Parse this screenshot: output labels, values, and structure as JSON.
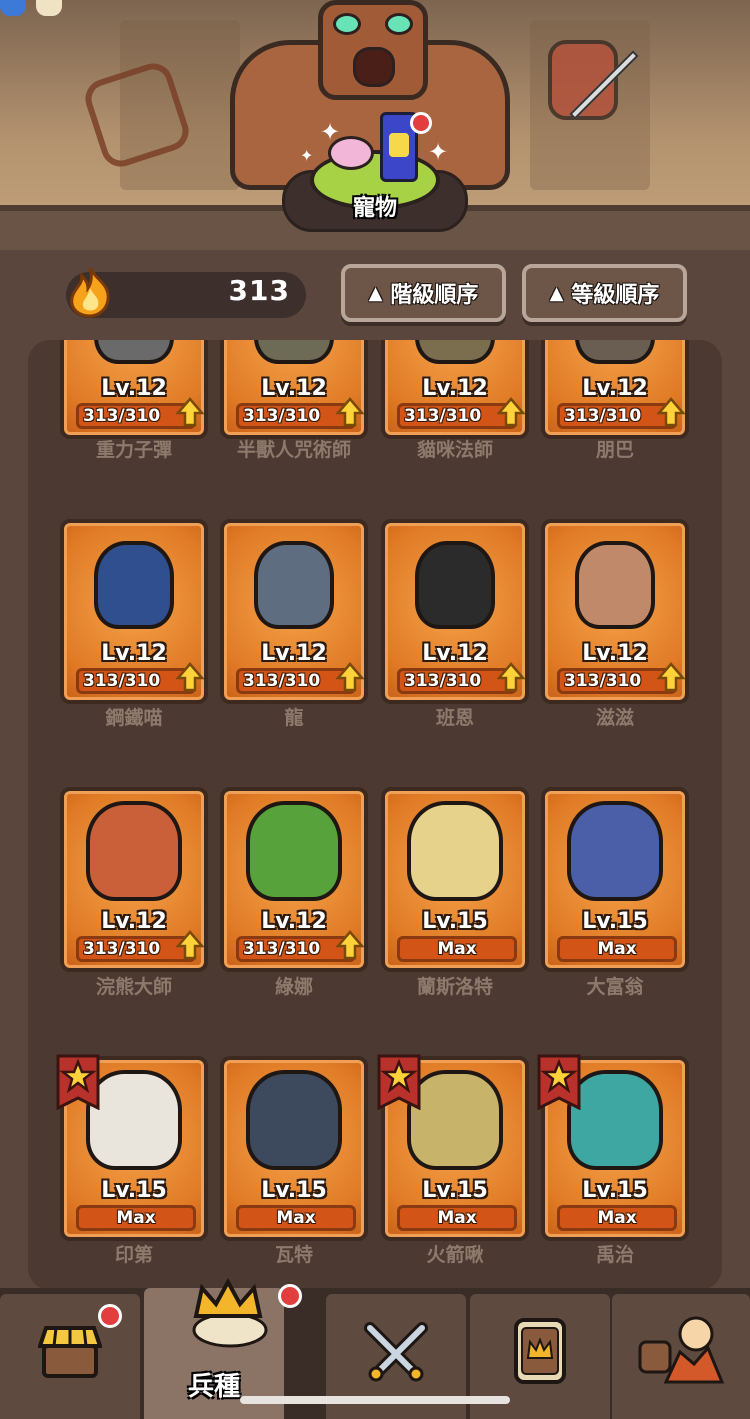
{
  "header": {
    "pet_label": "寵物"
  },
  "resource": {
    "icon": "flame-icon",
    "value": "313"
  },
  "sort_buttons": [
    {
      "label": "階級順序",
      "icon": "triangle-up-icon"
    },
    {
      "label": "等級順序",
      "icon": "triangle-up-icon"
    }
  ],
  "units": [
    {
      "name": "重力子彈",
      "level": "Lv.12",
      "progress": "313/310",
      "upgradable": true,
      "starred": false,
      "color": "#6a6a6a"
    },
    {
      "name": "半獸人咒術師",
      "level": "Lv.12",
      "progress": "313/310",
      "upgradable": true,
      "starred": false,
      "color": "#6d6a55"
    },
    {
      "name": "貓咪法師",
      "level": "Lv.12",
      "progress": "313/310",
      "upgradable": true,
      "starred": false,
      "color": "#7a6e4e"
    },
    {
      "name": "朋巴",
      "level": "Lv.12",
      "progress": "313/310",
      "upgradable": true,
      "starred": false,
      "color": "#6a5e52"
    },
    {
      "name": "鋼鐵喵",
      "level": "Lv.12",
      "progress": "313/310",
      "upgradable": true,
      "starred": false,
      "color": "#2f4f8f"
    },
    {
      "name": "龍",
      "level": "Lv.12",
      "progress": "313/310",
      "upgradable": true,
      "starred": false,
      "color": "#5f6d80"
    },
    {
      "name": "班恩",
      "level": "Lv.12",
      "progress": "313/310",
      "upgradable": true,
      "starred": false,
      "color": "#2b2b2b"
    },
    {
      "name": "滋滋",
      "level": "Lv.12",
      "progress": "313/310",
      "upgradable": true,
      "starred": false,
      "color": "#c08a6a"
    },
    {
      "name": "浣熊大師",
      "level": "Lv.12",
      "progress": "313/310",
      "upgradable": true,
      "starred": false,
      "color": "#c9603a"
    },
    {
      "name": "綠娜",
      "level": "Lv.12",
      "progress": "313/310",
      "upgradable": true,
      "starred": false,
      "color": "#58a23c"
    },
    {
      "name": "蘭斯洛特",
      "level": "Lv.15",
      "progress": "Max",
      "upgradable": false,
      "starred": false,
      "color": "#e6d28a"
    },
    {
      "name": "大富翁",
      "level": "Lv.15",
      "progress": "Max",
      "upgradable": false,
      "starred": false,
      "color": "#4a5fa8"
    },
    {
      "name": "印第",
      "level": "Lv.15",
      "progress": "Max",
      "upgradable": false,
      "starred": true,
      "color": "#e9e4dc"
    },
    {
      "name": "瓦特",
      "level": "Lv.15",
      "progress": "Max",
      "upgradable": false,
      "starred": false,
      "color": "#3d4a5e"
    },
    {
      "name": "火箭啾",
      "level": "Lv.15",
      "progress": "Max",
      "upgradable": false,
      "starred": true,
      "color": "#c8b36a"
    },
    {
      "name": "禹治",
      "level": "Lv.15",
      "progress": "Max",
      "upgradable": false,
      "starred": true,
      "color": "#3fa7a2"
    }
  ],
  "bottom_nav": [
    {
      "id": "shop",
      "icon": "shop-stall-icon",
      "label": "",
      "active": false,
      "notification": true
    },
    {
      "id": "units",
      "icon": "crown-icon",
      "label": "兵種",
      "active": true,
      "notification": true
    },
    {
      "id": "battle",
      "icon": "crossed-swords-icon",
      "label": "",
      "active": false,
      "notification": false
    },
    {
      "id": "cards",
      "icon": "crown-card-icon",
      "label": "",
      "active": false,
      "notification": false
    },
    {
      "id": "heroes",
      "icon": "heroes-group-icon",
      "label": "",
      "active": false,
      "notification": false
    }
  ],
  "colors": {
    "card_orange": "#e07a25",
    "bar_orange": "#d25416",
    "background": "#5a463c",
    "panel": "#4c3a32"
  }
}
